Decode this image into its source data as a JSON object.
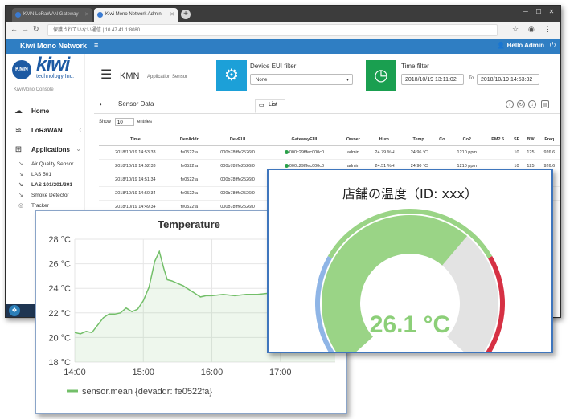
{
  "browser": {
    "tabs": [
      {
        "label": "KMN LoRaWAN Gateway"
      },
      {
        "label": "Kiwi Mono Network Admin"
      }
    ],
    "address": "保護されていない通信 | 10.47.41.1:8080",
    "new_tab_symbol": "+"
  },
  "app": {
    "brand": "Kiwi Mono Network",
    "user_greeting": "Hello Admin",
    "logo_text": "kiwi",
    "logo_sub": "technology Inc.",
    "logo_badge": "KMN",
    "console_label": "KiwiMono Console"
  },
  "sidebar": {
    "items": [
      {
        "label": "Home",
        "icon": "cloud-icon"
      },
      {
        "label": "LoRaWAN",
        "icon": "wifi-icon"
      },
      {
        "label": "Applications",
        "icon": "windows-icon"
      }
    ],
    "subitems": [
      {
        "label": "Air Quality Sensor",
        "active": false
      },
      {
        "label": "LAS 501",
        "active": false
      },
      {
        "label": "LAS 101/201/301",
        "active": true
      },
      {
        "label": "Smoke Detector",
        "active": false
      },
      {
        "label": "Tracker",
        "active": false
      }
    ]
  },
  "main": {
    "app_code": "KMN",
    "app_subtitle": "Application Sensor",
    "device_filter": {
      "title": "Device EUI filter",
      "value": "None"
    },
    "time_filter": {
      "title": "Time filter",
      "from": "2018/10/19 13:11:02",
      "to_label": "To",
      "to": "2018/10/19 14:53:32"
    },
    "tabs": [
      {
        "label": "Sensor Data"
      },
      {
        "label": "List"
      }
    ],
    "show_label": "Show",
    "show_value": "10",
    "entries_label": "entries",
    "table": {
      "columns": [
        "Time",
        "DevAddr",
        "DevEUI",
        "GatewayEUI",
        "Owner",
        "Hum.",
        "Temp.",
        "Co",
        "Co2",
        "PM2.5",
        "SF",
        "BW",
        "Freq"
      ],
      "rows": [
        [
          "2018/10/19 14:53:33",
          "fe0522fa",
          "000b78fffe2526f0",
          "000c29fffec000c0",
          "admin",
          "24.79 %H",
          "24.96 °C",
          "",
          "1210 ppm",
          "",
          "10",
          "125",
          "926.6"
        ],
        [
          "2018/10/19 14:52:33",
          "fe0522fa",
          "000b78fffe2526f0",
          "000c29fffec000c0",
          "admin",
          "24.51 %H",
          "24.90 °C",
          "",
          "1210 ppm",
          "",
          "10",
          "125",
          "926.6"
        ],
        [
          "2018/10/19 14:51:34",
          "fe0522fa",
          "000b78fffe2526f0",
          "000c29fffec000c0",
          "",
          "",
          "",
          "",
          "",
          "",
          "",
          "",
          ""
        ],
        [
          "2018/10/19 14:50:34",
          "fe0522fa",
          "000b78fffe2526f0",
          "000c29fffec000c0",
          "",
          "",
          "",
          "",
          "",
          "",
          "",
          "",
          ""
        ],
        [
          "2018/10/19 14:49:34",
          "fe0522fa",
          "000b78fffe2526f0",
          "000c29fffec000c0",
          "",
          "",
          "",
          "",
          "",
          "",
          "",
          "",
          ""
        ]
      ]
    }
  },
  "gauge": {
    "title": "店舗の温度（ID: xxx）",
    "value_label": "26.1 °C",
    "value": 26.1,
    "colors": {
      "fill": "#9ad486",
      "track": "#e3e3e3",
      "low": "#8fb5e6",
      "high": "#d63144",
      "value_text": "#8ccf78"
    }
  },
  "chart_data": {
    "type": "area",
    "title": "Temperature",
    "ylim": [
      18,
      28
    ],
    "yticks": [
      "18 °C",
      "20 °C",
      "22 °C",
      "24 °C",
      "26 °C",
      "28 °C"
    ],
    "yticks_values": [
      18,
      20,
      22,
      24,
      26,
      28
    ],
    "xticks": [
      "14:00",
      "15:00",
      "16:00",
      "17:00"
    ],
    "xticks_values": [
      "14:00",
      "15:00",
      "16:00",
      "17:00"
    ],
    "xlim": [
      "14:00",
      "17:48"
    ],
    "grid": true,
    "legend_position": "bottom-left",
    "color": "#73bf69",
    "series": [
      {
        "name": "sensor.mean {devaddr: fe0522fa}",
        "x": [
          "14:00",
          "14:05",
          "14:10",
          "14:15",
          "14:20",
          "14:25",
          "14:30",
          "14:35",
          "14:40",
          "14:45",
          "14:50",
          "14:55",
          "15:00",
          "15:05",
          "15:10",
          "15:14",
          "15:18",
          "15:21",
          "15:25",
          "15:30",
          "15:35",
          "15:40",
          "15:45",
          "15:50",
          "15:55",
          "16:00",
          "16:10",
          "16:20",
          "16:30",
          "16:40",
          "16:50",
          "17:00",
          "17:10",
          "17:20",
          "17:30",
          "17:40",
          "17:48"
        ],
        "y": [
          20.4,
          20.3,
          20.5,
          20.4,
          21.0,
          21.6,
          21.9,
          21.9,
          22.0,
          22.4,
          22.1,
          22.3,
          23.0,
          24.1,
          26.2,
          27.0,
          25.6,
          24.7,
          24.6,
          24.4,
          24.2,
          23.9,
          23.6,
          23.3,
          23.4,
          23.4,
          23.5,
          23.4,
          23.5,
          23.5,
          23.6,
          23.6,
          23.7,
          23.8,
          24.0,
          24.1,
          24.1
        ]
      }
    ]
  }
}
